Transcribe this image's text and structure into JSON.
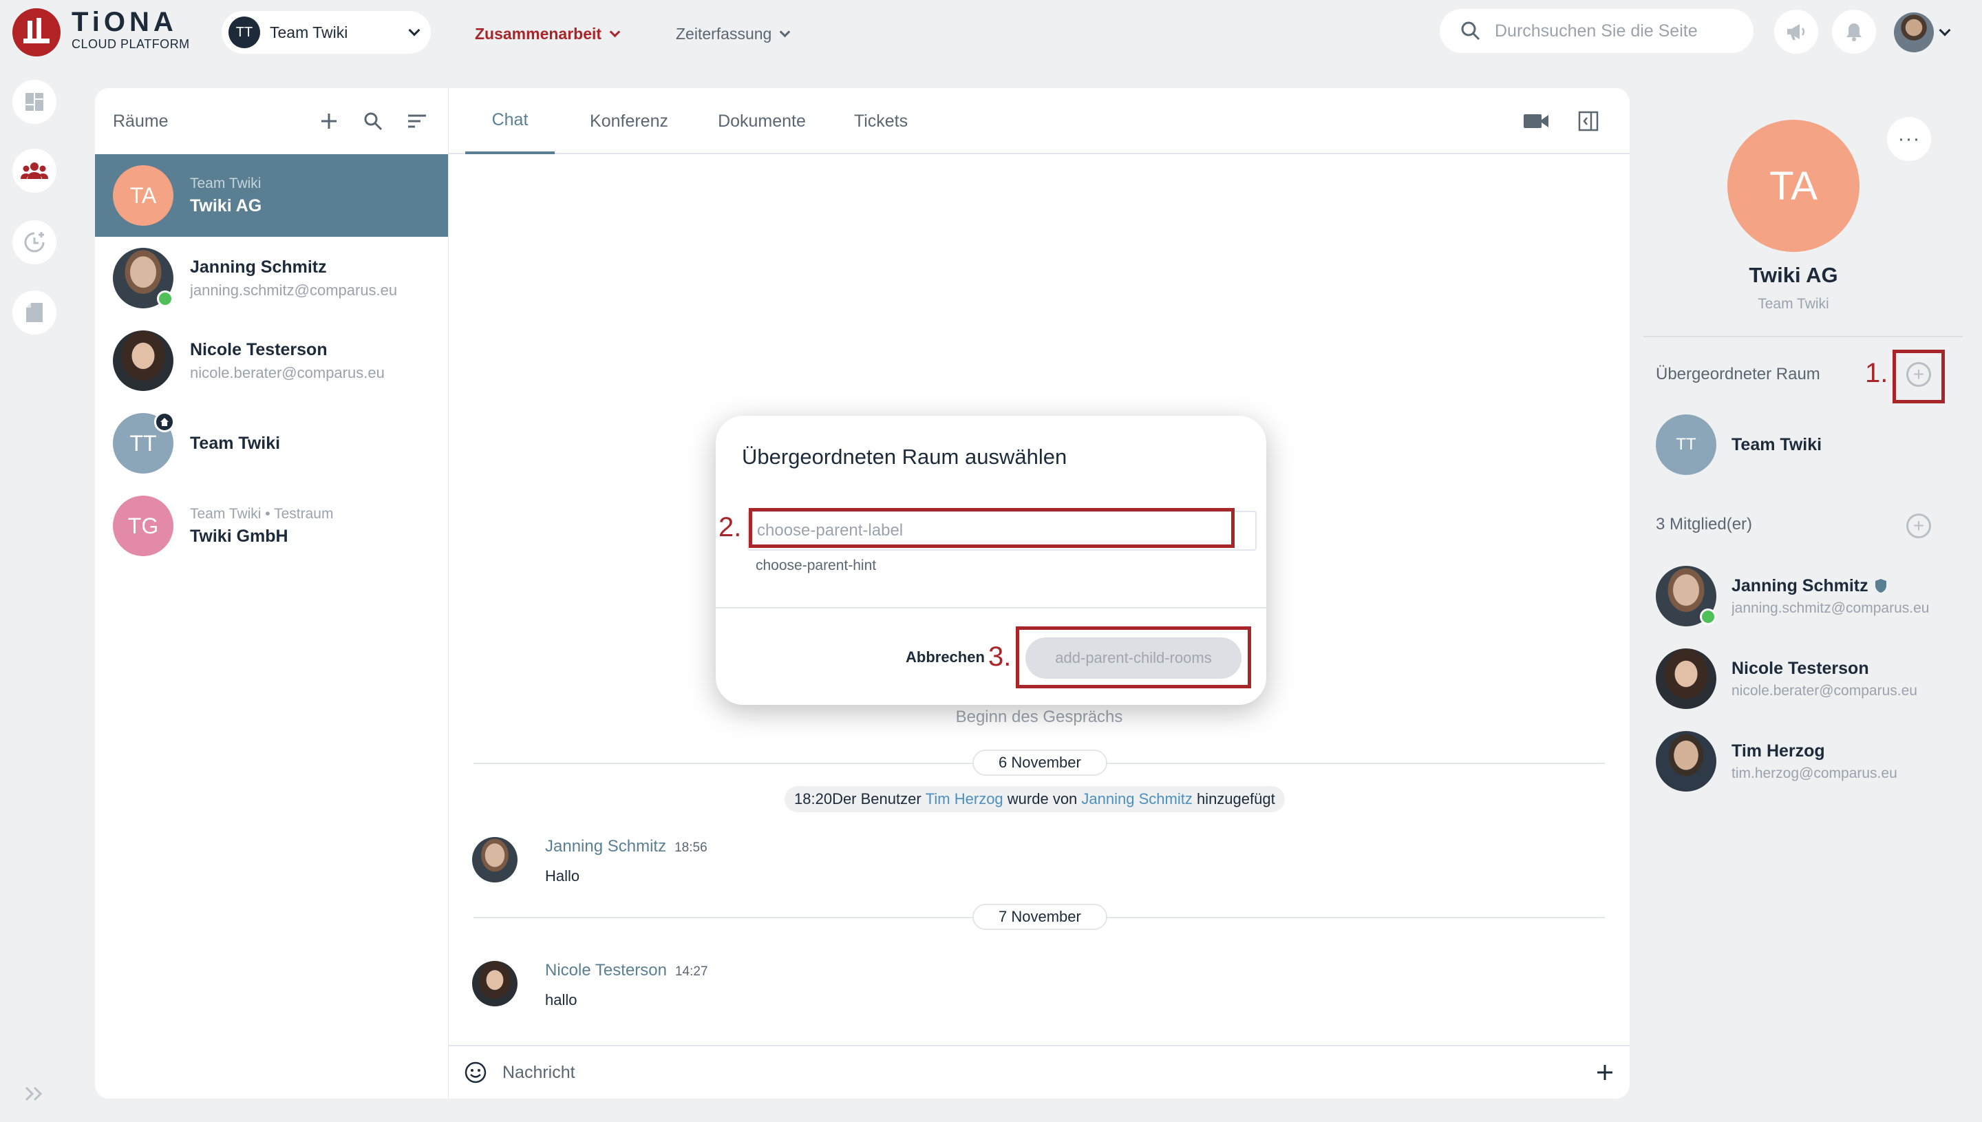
{
  "header": {
    "logo_title": "TiONA",
    "logo_subtitle": "CLOUD PLATFORM",
    "team_selector": {
      "avatar": "TT",
      "label": "Team Twiki"
    },
    "nav": [
      {
        "label": "Zusammenarbeit",
        "active": true
      },
      {
        "label": "Zeiterfassung",
        "active": false
      }
    ],
    "search_placeholder": "Durchsuchen Sie die Seite",
    "icons": [
      "megaphone-icon",
      "bell-icon",
      "user-avatar"
    ]
  },
  "rail": [
    "dashboard-icon",
    "people-icon",
    "time-tracking-icon",
    "document-icon",
    "expand-icon"
  ],
  "rooms_panel": {
    "title": "Räume",
    "rooms": [
      {
        "initials": "TA",
        "sub": "Team Twiki",
        "name": "Twiki AG",
        "active": true,
        "color": "#f4a384"
      },
      {
        "sub": "",
        "name": "Janning Schmitz",
        "mail": "janning.schmitz@comparus.eu",
        "online": true
      },
      {
        "sub": "",
        "name": "Nicole Testerson",
        "mail": "nicole.berater@comparus.eu"
      },
      {
        "initials": "TT",
        "name": "Team Twiki",
        "color": "#8aa6b8"
      },
      {
        "initials": "TG",
        "sub": "Team Twiki • Testraum",
        "name": "Twiki GmbH",
        "color": "#e28aa8"
      }
    ]
  },
  "chat": {
    "tabs": [
      "Chat",
      "Konferenz",
      "Dokumente",
      "Tickets"
    ],
    "active_tab": "Chat",
    "conversation_start": "Beginn des Gesprächs",
    "dates": [
      "6 November",
      "7 November"
    ],
    "system_message": {
      "time": "18:20",
      "text1": "Der Benutzer ",
      "user1": "Tim Herzog",
      "text2": " wurde von ",
      "user2": "Janning Schmitz",
      "text3": " hinzugefügt"
    },
    "messages": [
      {
        "author": "Janning Schmitz",
        "time": "18:56",
        "text": "Hallo"
      },
      {
        "author": "Nicole Testerson",
        "time": "14:27",
        "text": "hallo"
      }
    ],
    "composer_placeholder": "Nachricht"
  },
  "info_panel": {
    "initials": "TA",
    "name": "Twiki AG",
    "sub": "Team Twiki",
    "more": "···",
    "parent_room_title": "Übergeordneter Raum",
    "parent_room": {
      "initials": "TT",
      "name": "Team Twiki"
    },
    "members_title": "3 Mitglied(er)",
    "members": [
      {
        "name": "Janning Schmitz",
        "mail": "janning.schmitz@comparus.eu",
        "admin": true,
        "online": true
      },
      {
        "name": "Nicole Testerson",
        "mail": "nicole.berater@comparus.eu"
      },
      {
        "name": "Tim Herzog",
        "mail": "tim.herzog@comparus.eu"
      }
    ]
  },
  "modal": {
    "title": "Übergeordneten Raum auswählen",
    "input_placeholder": "choose-parent-label",
    "hint": "choose-parent-hint",
    "cancel_label": "Abbrechen",
    "submit_label": "add-parent-child-rooms"
  },
  "annotations": [
    "1.",
    "2.",
    "3."
  ],
  "colors": {
    "brand_red": "#b22325",
    "accent": "#5a7f93",
    "annotation": "#a8262a",
    "online": "#4fbf58"
  }
}
